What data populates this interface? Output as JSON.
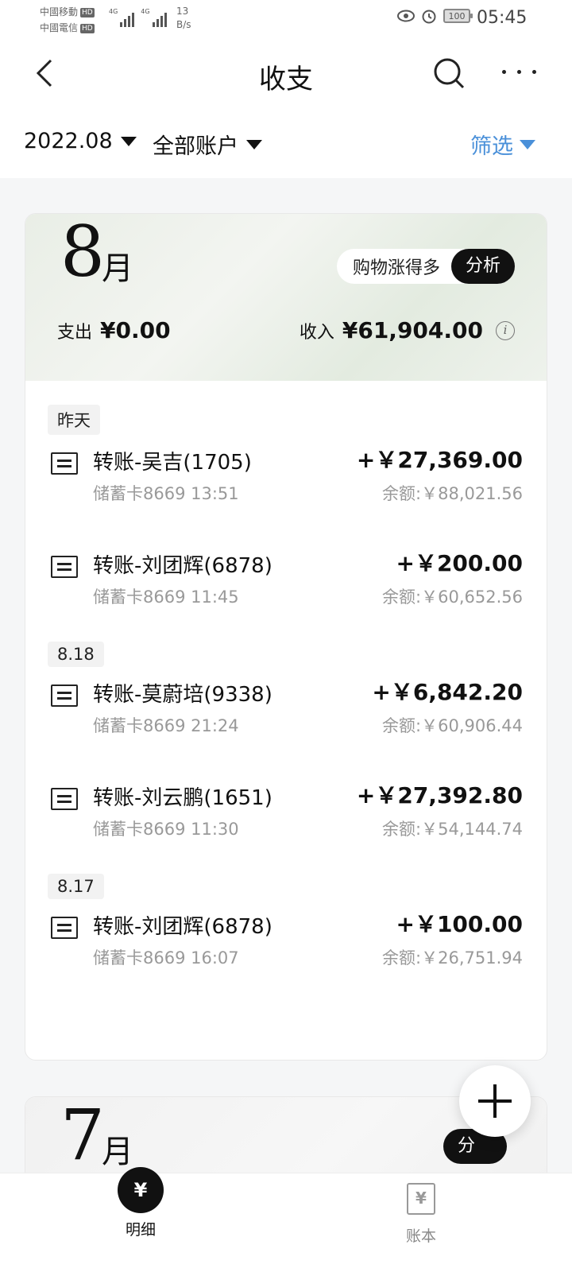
{
  "status_bar": {
    "carrier1": "中國移動",
    "carrier2": "中國電信",
    "hd": "HD",
    "net": "4G",
    "speed_value": "13",
    "speed_unit": "B/s",
    "battery": "100",
    "time": "05:45"
  },
  "header": {
    "title": "收支",
    "icons": [
      "back-icon",
      "search-icon",
      "more-icon"
    ]
  },
  "filters": {
    "month": "2022.08",
    "account": "全部账户",
    "filter_label": "筛选"
  },
  "months": [
    {
      "number": "8",
      "unit": "月",
      "tag_text": "购物涨得多",
      "tag_button": "分析",
      "spend_label": "支出",
      "spend_amount": "¥0.00",
      "income_label": "收入",
      "income_amount": "¥61,904.00",
      "info": "i",
      "days": [
        {
          "label": "昨天",
          "transactions": [
            {
              "name": "转账-吴吉(1705)",
              "sub": "储蓄卡8669 13:51",
              "amount": "+￥27,369.00",
              "balance": "余额:￥88,021.56"
            },
            {
              "name": "转账-刘团辉(6878)",
              "sub": "储蓄卡8669 11:45",
              "amount": "+￥200.00",
              "balance": "余额:￥60,652.56"
            }
          ]
        },
        {
          "label": "8.18",
          "transactions": [
            {
              "name": "转账-莫蔚培(9338)",
              "sub": "储蓄卡8669 21:24",
              "amount": "+￥6,842.20",
              "balance": "余额:￥60,906.44"
            },
            {
              "name": "转账-刘云鹏(1651)",
              "sub": "储蓄卡8669 11:30",
              "amount": "+￥27,392.80",
              "balance": "余额:￥54,144.74"
            }
          ]
        },
        {
          "label": "8.17",
          "transactions": [
            {
              "name": "转账-刘团辉(6878)",
              "sub": "储蓄卡8669 16:07",
              "amount": "+￥100.00",
              "balance": "余额:￥26,751.94"
            }
          ]
        }
      ]
    },
    {
      "number": "7",
      "unit": "月",
      "tag_button": "分"
    }
  ],
  "bottom_nav": {
    "detail_label": "明细",
    "detail_icon_glyph": "¥",
    "book_label": "账本",
    "book_icon_glyph": "¥"
  }
}
